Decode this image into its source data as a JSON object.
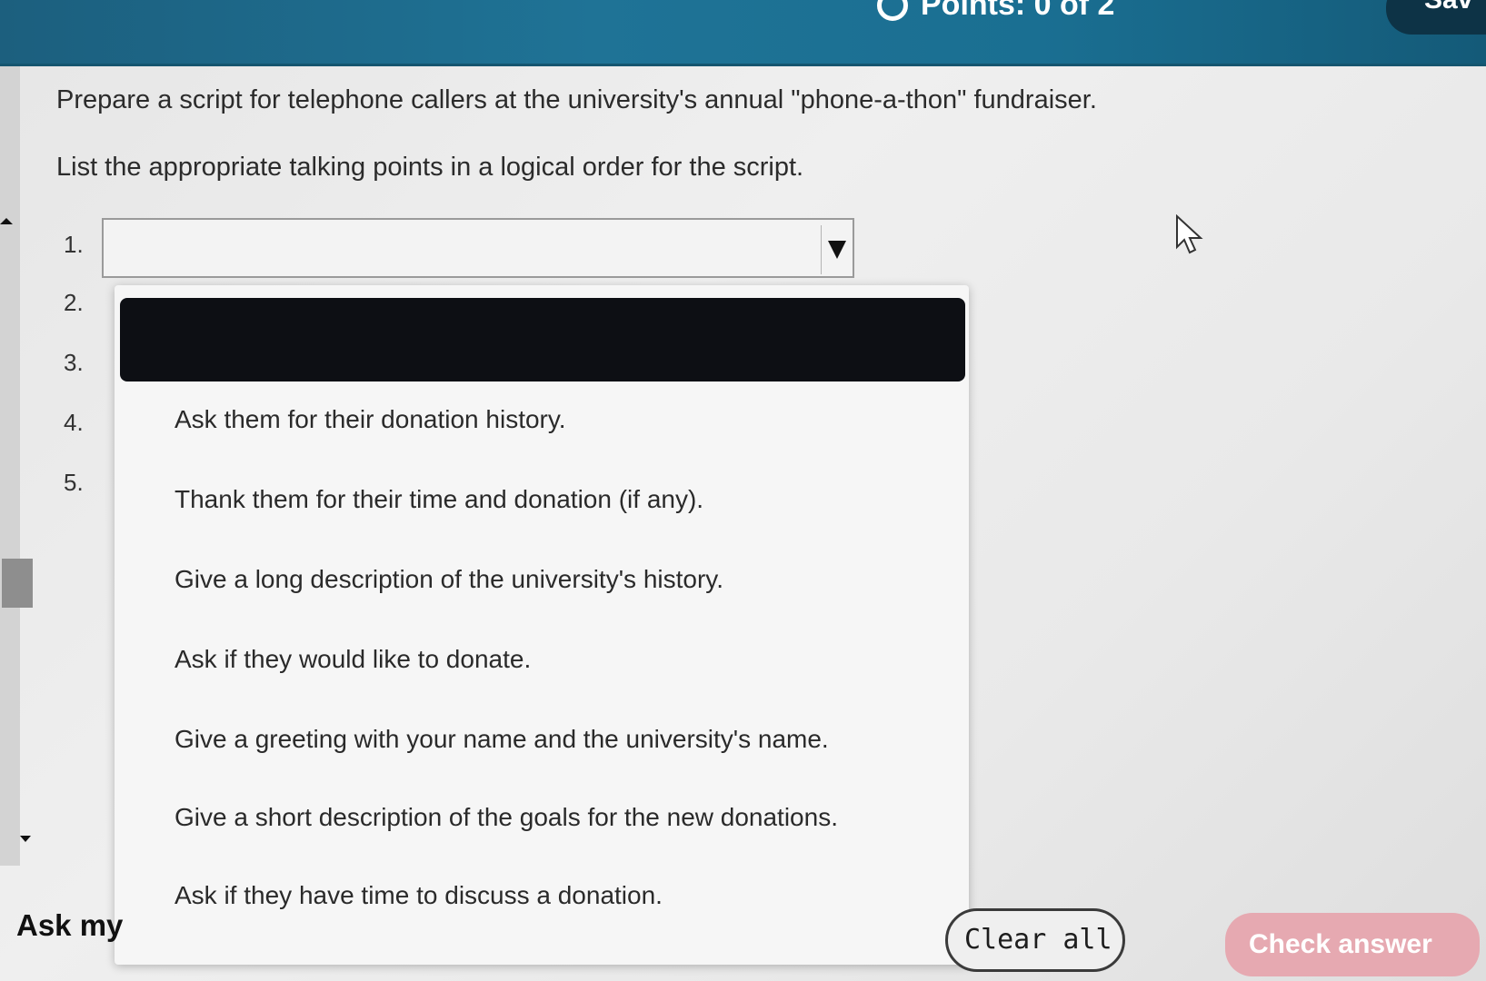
{
  "header": {
    "points_label": "Points: 0 of 2",
    "save_label": "Sav"
  },
  "question": {
    "prompt": "Prepare a script for telephone callers at the university's annual \"phone-a-thon\" fundraiser.",
    "instruction": "List the appropriate talking points in a logical order for the script."
  },
  "list_numbers": [
    "1.",
    "2.",
    "3.",
    "4.",
    "5."
  ],
  "dropdown": {
    "options": [
      "Ask them for their donation history.",
      "Thank them for their time and donation (if any).",
      "Give a long description of the university's history.",
      "Ask if they would like to donate.",
      "Give a greeting with your name and the university's name.",
      "Give a short description of the goals for the new donations.",
      "Ask if they have time to discuss a donation."
    ]
  },
  "footer": {
    "ask_label": "Ask my",
    "clear_all_label": "Clear all",
    "check_answer_label": "Check answer"
  },
  "colors": {
    "topbar": "#1f7396",
    "check_answer_bg": "#e6a9b1",
    "selected_option_bg": "#0d0f14"
  }
}
